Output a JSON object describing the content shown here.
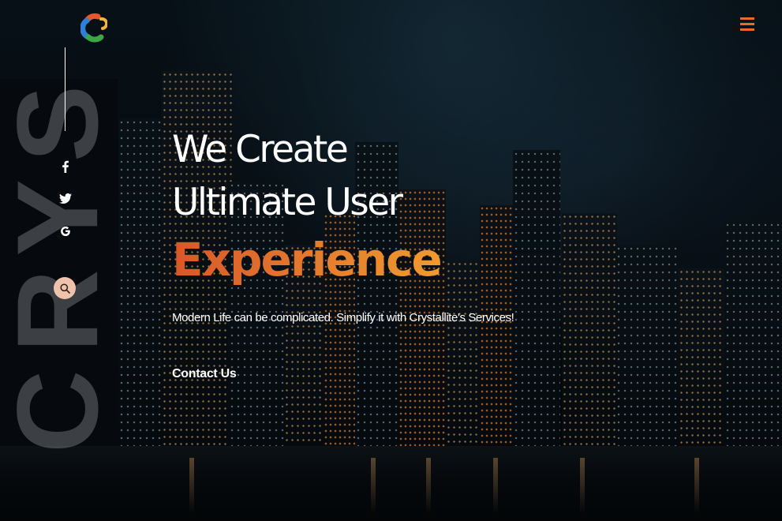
{
  "brand": {
    "logo_icon": "crystallite-logo-icon",
    "watermark": "CRYS",
    "accent_color": "#e46c2c"
  },
  "header": {
    "menu_icon": "hamburger-menu-icon"
  },
  "sidebar": {
    "social": [
      {
        "icon": "facebook-icon"
      },
      {
        "icon": "twitter-icon"
      },
      {
        "icon": "google-icon"
      }
    ],
    "search_icon": "search-icon"
  },
  "hero": {
    "line1": "We Create",
    "line2": "Ultimate User",
    "accent": "Experience",
    "subtitle": "Modern Life can be complicated. Simplify it with Crystallite's Services!",
    "cta_label": "Contact Us"
  }
}
